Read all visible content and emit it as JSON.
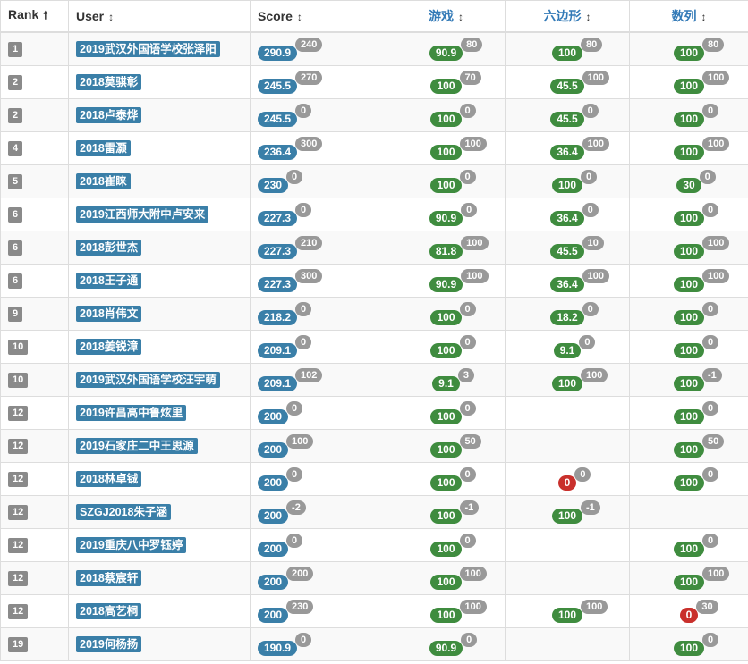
{
  "header": {
    "rank": "Rank",
    "user": "User",
    "score": "Score",
    "problems": [
      "游戏",
      "六边形",
      "数列"
    ],
    "sort_up": "🠕",
    "sort_both": "↕"
  },
  "colors": {
    "user": "#3a7fa8",
    "score": "#3a7fa8",
    "full": "#3f8c3f",
    "zero": "#c9302c",
    "badge": "#999999",
    "rank": "#8a8a8a"
  },
  "rows": [
    {
      "rank": "1",
      "user": "2019武汉外国语学校张泽阳",
      "score": "290.9",
      "score_badge": "240",
      "cells": [
        {
          "v": "90.9",
          "b": "80",
          "c": "green"
        },
        {
          "v": "100",
          "b": "80",
          "c": "green"
        },
        {
          "v": "100",
          "b": "80",
          "c": "green"
        }
      ]
    },
    {
      "rank": "2",
      "user": "2018莫骐彰",
      "score": "245.5",
      "score_badge": "270",
      "cells": [
        {
          "v": "100",
          "b": "70",
          "c": "green"
        },
        {
          "v": "45.5",
          "b": "100",
          "c": "green"
        },
        {
          "v": "100",
          "b": "100",
          "c": "green"
        }
      ]
    },
    {
      "rank": "2",
      "user": "2018卢泰烨",
      "score": "245.5",
      "score_badge": "0",
      "cells": [
        {
          "v": "100",
          "b": "0",
          "c": "green"
        },
        {
          "v": "45.5",
          "b": "0",
          "c": "green"
        },
        {
          "v": "100",
          "b": "0",
          "c": "green"
        }
      ]
    },
    {
      "rank": "4",
      "user": "2018雷灏",
      "score": "236.4",
      "score_badge": "300",
      "cells": [
        {
          "v": "100",
          "b": "100",
          "c": "green"
        },
        {
          "v": "36.4",
          "b": "100",
          "c": "green"
        },
        {
          "v": "100",
          "b": "100",
          "c": "green"
        }
      ]
    },
    {
      "rank": "5",
      "user": "2018崔睐",
      "score": "230",
      "score_badge": "0",
      "cells": [
        {
          "v": "100",
          "b": "0",
          "c": "green"
        },
        {
          "v": "100",
          "b": "0",
          "c": "green"
        },
        {
          "v": "30",
          "b": "0",
          "c": "green"
        }
      ]
    },
    {
      "rank": "6",
      "user": "2019江西师大附中卢安来",
      "score": "227.3",
      "score_badge": "0",
      "cells": [
        {
          "v": "90.9",
          "b": "0",
          "c": "green"
        },
        {
          "v": "36.4",
          "b": "0",
          "c": "green"
        },
        {
          "v": "100",
          "b": "0",
          "c": "green"
        }
      ]
    },
    {
      "rank": "6",
      "user": "2018彭世杰",
      "score": "227.3",
      "score_badge": "210",
      "cells": [
        {
          "v": "81.8",
          "b": "100",
          "c": "green"
        },
        {
          "v": "45.5",
          "b": "10",
          "c": "green"
        },
        {
          "v": "100",
          "b": "100",
          "c": "green"
        }
      ]
    },
    {
      "rank": "6",
      "user": "2018王子通",
      "score": "227.3",
      "score_badge": "300",
      "cells": [
        {
          "v": "90.9",
          "b": "100",
          "c": "green"
        },
        {
          "v": "36.4",
          "b": "100",
          "c": "green"
        },
        {
          "v": "100",
          "b": "100",
          "c": "green"
        }
      ]
    },
    {
      "rank": "9",
      "user": "2018肖伟文",
      "score": "218.2",
      "score_badge": "0",
      "cells": [
        {
          "v": "100",
          "b": "0",
          "c": "green"
        },
        {
          "v": "18.2",
          "b": "0",
          "c": "green"
        },
        {
          "v": "100",
          "b": "0",
          "c": "green"
        }
      ]
    },
    {
      "rank": "10",
      "user": "2018姜锐漳",
      "score": "209.1",
      "score_badge": "0",
      "cells": [
        {
          "v": "100",
          "b": "0",
          "c": "green"
        },
        {
          "v": "9.1",
          "b": "0",
          "c": "green"
        },
        {
          "v": "100",
          "b": "0",
          "c": "green"
        }
      ]
    },
    {
      "rank": "10",
      "user": "2019武汉外国语学校汪宇萌",
      "score": "209.1",
      "score_badge": "102",
      "cells": [
        {
          "v": "9.1",
          "b": "3",
          "c": "green"
        },
        {
          "v": "100",
          "b": "100",
          "c": "green"
        },
        {
          "v": "100",
          "b": "-1",
          "c": "green"
        }
      ]
    },
    {
      "rank": "12",
      "user": "2019许昌高中鲁炫里",
      "score": "200",
      "score_badge": "0",
      "cells": [
        {
          "v": "100",
          "b": "0",
          "c": "green"
        },
        null,
        {
          "v": "100",
          "b": "0",
          "c": "green"
        }
      ]
    },
    {
      "rank": "12",
      "user": "2019石家庄二中王思源",
      "score": "200",
      "score_badge": "100",
      "cells": [
        {
          "v": "100",
          "b": "50",
          "c": "green"
        },
        null,
        {
          "v": "100",
          "b": "50",
          "c": "green"
        }
      ]
    },
    {
      "rank": "12",
      "user": "2018林卓铖",
      "score": "200",
      "score_badge": "0",
      "cells": [
        {
          "v": "100",
          "b": "0",
          "c": "green"
        },
        {
          "v": "0",
          "b": "0",
          "c": "red"
        },
        {
          "v": "100",
          "b": "0",
          "c": "green"
        }
      ]
    },
    {
      "rank": "12",
      "user": "SZGJ2018朱子涵",
      "score": "200",
      "score_badge": "-2",
      "cells": [
        {
          "v": "100",
          "b": "-1",
          "c": "green"
        },
        {
          "v": "100",
          "b": "-1",
          "c": "green"
        },
        null
      ]
    },
    {
      "rank": "12",
      "user": "2019重庆八中罗钰婷",
      "score": "200",
      "score_badge": "0",
      "cells": [
        {
          "v": "100",
          "b": "0",
          "c": "green"
        },
        null,
        {
          "v": "100",
          "b": "0",
          "c": "green"
        }
      ]
    },
    {
      "rank": "12",
      "user": "2018蔡宸轩",
      "score": "200",
      "score_badge": "200",
      "cells": [
        {
          "v": "100",
          "b": "100",
          "c": "green"
        },
        null,
        {
          "v": "100",
          "b": "100",
          "c": "green"
        }
      ]
    },
    {
      "rank": "12",
      "user": "2018高艺桐",
      "score": "200",
      "score_badge": "230",
      "cells": [
        {
          "v": "100",
          "b": "100",
          "c": "green"
        },
        {
          "v": "100",
          "b": "100",
          "c": "green"
        },
        {
          "v": "0",
          "b": "30",
          "c": "red"
        }
      ]
    },
    {
      "rank": "19",
      "user": "2019何杨扬",
      "score": "190.9",
      "score_badge": "0",
      "cells": [
        {
          "v": "90.9",
          "b": "0",
          "c": "green"
        },
        null,
        {
          "v": "100",
          "b": "0",
          "c": "green"
        }
      ]
    }
  ]
}
